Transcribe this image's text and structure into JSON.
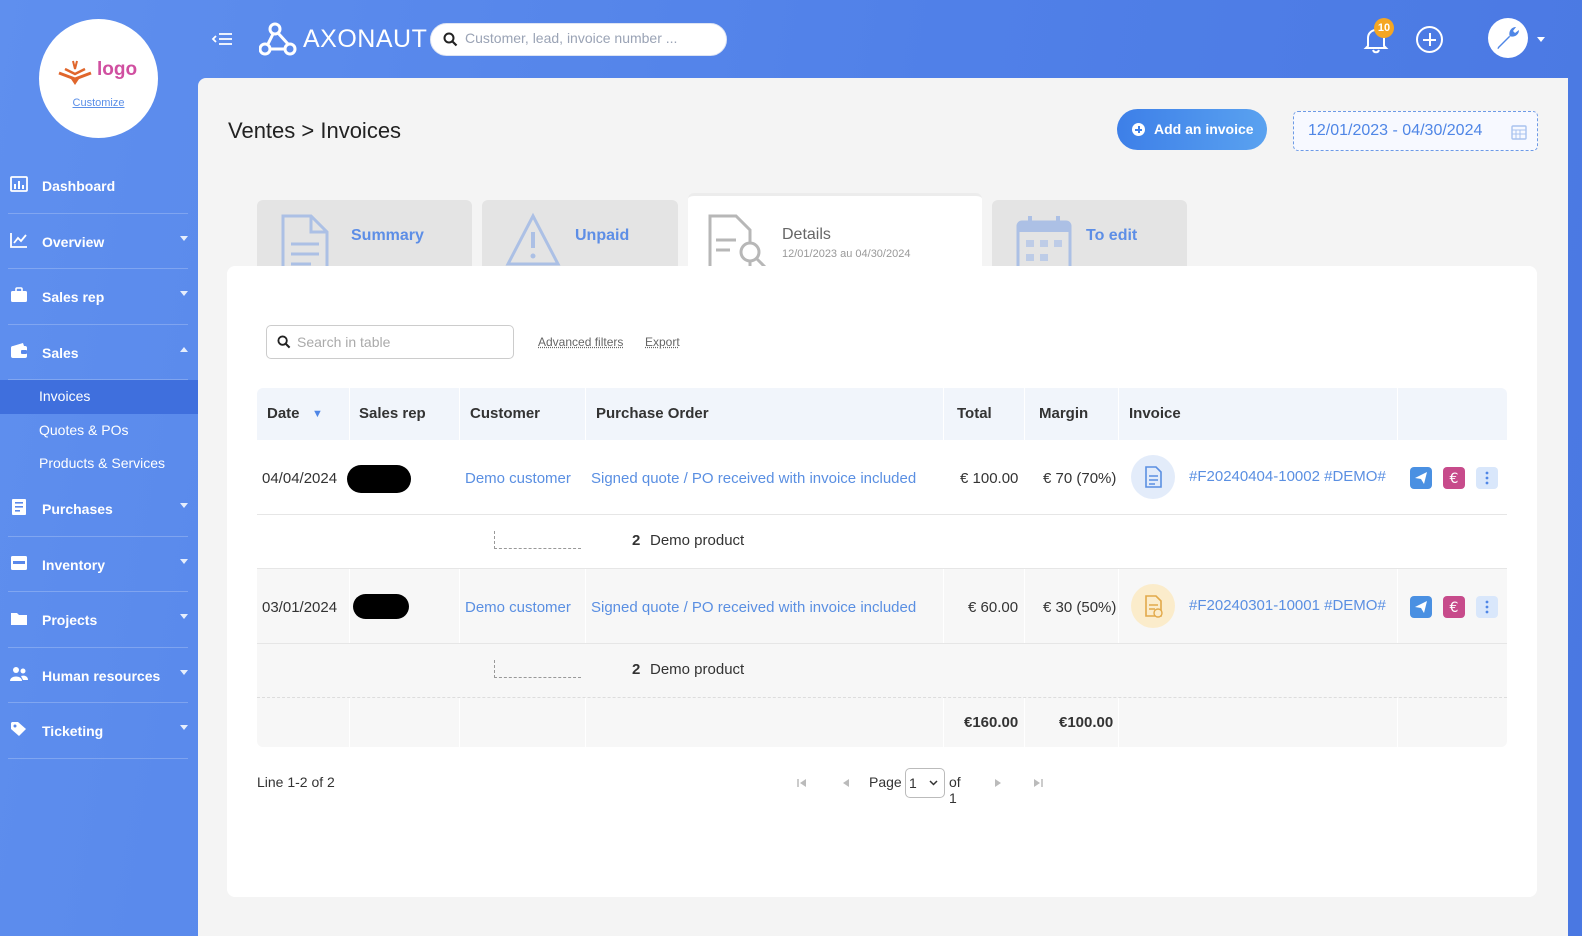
{
  "sidebar": {
    "logo_text": "logo",
    "customize_label": "Customize",
    "items": [
      {
        "label": "Dashboard",
        "icon": "chart-bar-icon",
        "caret": ""
      },
      {
        "label": "Overview",
        "icon": "chart-line-icon",
        "caret": "down"
      },
      {
        "label": "Sales rep",
        "icon": "briefcase-icon",
        "caret": "down"
      },
      {
        "label": "Sales",
        "icon": "wallet-icon",
        "caret": "up"
      },
      {
        "label": "Purchases",
        "icon": "receipt-icon",
        "caret": "down"
      },
      {
        "label": "Inventory",
        "icon": "inbox-icon",
        "caret": "down"
      },
      {
        "label": "Projects",
        "icon": "folder-icon",
        "caret": "down"
      },
      {
        "label": "Human resources",
        "icon": "users-icon",
        "caret": "down"
      },
      {
        "label": "Ticketing",
        "icon": "tag-icon",
        "caret": "down"
      }
    ],
    "sales_sub": [
      "Invoices",
      "Quotes & POs",
      "Products & Services"
    ],
    "active_sub": "Invoices"
  },
  "topbar": {
    "brand": "AXONAUT",
    "search_placeholder": "Customer, lead, invoice number ...",
    "notification_count": "10"
  },
  "header": {
    "breadcrumb": "Ventes > Invoices",
    "add_button": "Add an invoice",
    "date_range": "12/01/2023 - 04/30/2024"
  },
  "tabs": [
    {
      "label": "Summary",
      "icon": "document-icon"
    },
    {
      "label": "Unpaid",
      "icon": "warning-icon"
    },
    {
      "label": "Details",
      "sub": "12/01/2023 au 04/30/2024",
      "icon": "document-search-icon",
      "active": true
    },
    {
      "label": "To edit",
      "icon": "calendar-icon"
    }
  ],
  "table": {
    "search_placeholder": "Search in table",
    "advanced_filters": "Advanced filters",
    "export": "Export",
    "columns": [
      "Date",
      "Sales rep",
      "Customer",
      "Purchase Order",
      "Total",
      "Margin",
      "Invoice"
    ],
    "sort_indicator": "▼",
    "rows": [
      {
        "date": "04/04/2024",
        "customer": "Demo customer",
        "purchase_order": "Signed quote / PO received with invoice included",
        "total": "€ 100.00",
        "margin": "€ 70 (70%)",
        "invoice": "#F20240404-10002 #DEMO#",
        "invoice_status_color": "#e3ecfa",
        "sub_qty": "2",
        "sub_product": "Demo product"
      },
      {
        "date": "03/01/2024",
        "customer": "Demo customer",
        "purchase_order": "Signed quote / PO received with invoice included",
        "total": "€ 60.00",
        "margin": "€ 30 (50%)",
        "invoice": "#F20240301-10001 #DEMO#",
        "invoice_status_color": "#fbeccb",
        "sub_qty": "2",
        "sub_product": "Demo product"
      }
    ],
    "totals": {
      "total": "€160.00",
      "margin": "€100.00"
    }
  },
  "pager": {
    "lines": "Line 1-2 of 2",
    "page_label": "Page",
    "page_value": "1",
    "of_label": "of 1"
  },
  "colors": {
    "accent": "#4f86e6",
    "send_action": "#4a90e2",
    "pay_action": "#c74b8b",
    "more_action": "#d9e7fb"
  }
}
